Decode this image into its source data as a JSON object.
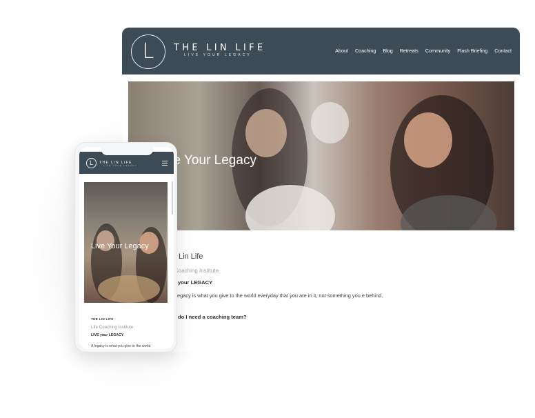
{
  "desktop": {
    "brand": "THE LIN LIFE",
    "tagline": "LIVE YOUR LEGACY",
    "logo_letter": "L",
    "nav": [
      "About",
      "Coaching",
      "Blog",
      "Retreats",
      "Community",
      "Flash Briefing",
      "Contact"
    ],
    "hero_title": "ve Your Legacy",
    "content": {
      "line1": "Lin Life",
      "line2": "Coaching Institute",
      "line3": "your LEGACY",
      "paragraph": "egacy is what you give to the world everyday that you are in it, not something you e behind.",
      "question": "do I need a coaching team?"
    }
  },
  "phone": {
    "brand": "THE LIN LIFE",
    "tagline": "LIVE YOUR LEGACY",
    "logo_letter": "L",
    "hero_title": "Live Your Legacy",
    "content": {
      "line1": "THE LIN LIFE",
      "line2": "Life Coaching Institute",
      "line3": "LIVE your LEGACY",
      "paragraph": "A legacy is what you give to the world everyday that you are in it"
    }
  },
  "colors": {
    "header_bg": "#3d4b57",
    "text_dark": "#2b2b2b",
    "text_muted": "#9aa3a8"
  }
}
